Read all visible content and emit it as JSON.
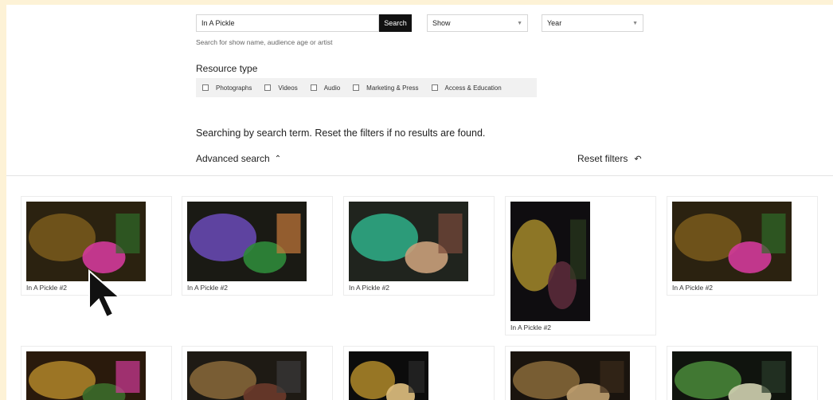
{
  "search": {
    "value": "In A Pickle",
    "button_label": "Search",
    "hint": "Search for show name, audience age or artist"
  },
  "filters": {
    "show_label": "Show",
    "year_label": "Year"
  },
  "resource_type": {
    "title": "Resource type",
    "options": [
      "Photographs",
      "Videos",
      "Audio",
      "Marketing & Press",
      "Access & Education"
    ]
  },
  "status_message": "Searching by search term. Reset the filters if no results are found.",
  "advanced_search_label": "Advanced search",
  "reset_filters_label": "Reset filters",
  "results": [
    {
      "caption": "In A Pickle #2",
      "palette": [
        "#2b2210",
        "#7a5a1c",
        "#d23a9a",
        "#2f6b2a"
      ]
    },
    {
      "caption": "In A Pickle #2",
      "palette": [
        "#1a1a14",
        "#6b4bb8",
        "#2f8a3a",
        "#c87a3a"
      ]
    },
    {
      "caption": "In A Pickle #2",
      "palette": [
        "#20241e",
        "#2fb08a",
        "#c9a07a",
        "#7a4a3a"
      ]
    },
    {
      "caption": "In A Pickle #2",
      "palette": [
        "#0f0d10",
        "#a38a2a",
        "#5a2a3a",
        "#2a3a1e"
      ]
    },
    {
      "caption": "In A Pickle #2",
      "palette": [
        "#2b2210",
        "#7a5a1c",
        "#d23a9a",
        "#2f6b2a"
      ]
    },
    {
      "caption": "",
      "palette": [
        "#2a1a0c",
        "#b0862a",
        "#3b6b2a",
        "#d23a9a"
      ]
    },
    {
      "caption": "",
      "palette": [
        "#1e1a14",
        "#8a6a3a",
        "#6a3a2a",
        "#3a3a3a"
      ]
    },
    {
      "caption": "",
      "palette": [
        "#0c0c0c",
        "#b08a2a",
        "#e0c080",
        "#2a2a2a"
      ]
    },
    {
      "caption": "",
      "palette": [
        "#1a140e",
        "#8a6a3a",
        "#c0a070",
        "#3a2a1a"
      ]
    },
    {
      "caption": "",
      "palette": [
        "#10140e",
        "#4a8a3a",
        "#d0d0b0",
        "#2a3a2a"
      ]
    }
  ]
}
